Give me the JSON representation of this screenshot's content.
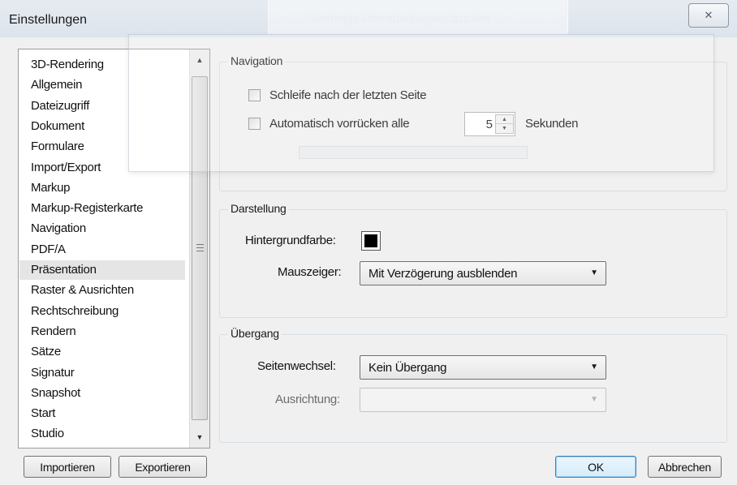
{
  "window": {
    "title": "Einstellungen",
    "ghost_title": "Vorherige Überarbeitungen drucken",
    "close_glyph": "✕"
  },
  "categories": {
    "items": [
      "3D-Rendering",
      "Allgemein",
      "Dateizugriff",
      "Dokument",
      "Formulare",
      "Import/Export",
      "Markup",
      "Markup-Registerkarte",
      "Navigation",
      "PDF/A",
      "Präsentation",
      "Raster & Ausrichten",
      "Rechtschreibung",
      "Rendern",
      "Sätze",
      "Signatur",
      "Snapshot",
      "Start",
      "Studio"
    ],
    "selected": "Präsentation",
    "scroll_up_glyph": "▲",
    "scroll_down_glyph": "▼"
  },
  "list_buttons": {
    "import": "Importieren",
    "export": "Exportieren"
  },
  "navigation": {
    "group_label": "Navigation",
    "loop_label": "Schleife nach der letzten Seite",
    "loop_checked": false,
    "auto_advance_label": "Automatisch vorrücken alle",
    "auto_advance_checked": false,
    "auto_advance_value": "5",
    "seconds_label": "Sekunden"
  },
  "display": {
    "group_label": "Darstellung",
    "background_label": "Hintergrundfarbe:",
    "background_color": "#000000",
    "cursor_label": "Mauszeiger:",
    "cursor_value": "Mit Verzögerung ausblenden"
  },
  "transition": {
    "group_label": "Übergang",
    "page_change_label": "Seitenwechsel:",
    "page_change_value": "Kein Übergang",
    "direction_label": "Ausrichtung:",
    "direction_value": ""
  },
  "dialog_buttons": {
    "ok": "OK",
    "cancel": "Abbrechen"
  },
  "icons": {
    "close": "close-icon",
    "dropdown": "chevron-down-icon",
    "spin_up": "chevron-up-icon",
    "spin_down": "chevron-down-icon"
  }
}
